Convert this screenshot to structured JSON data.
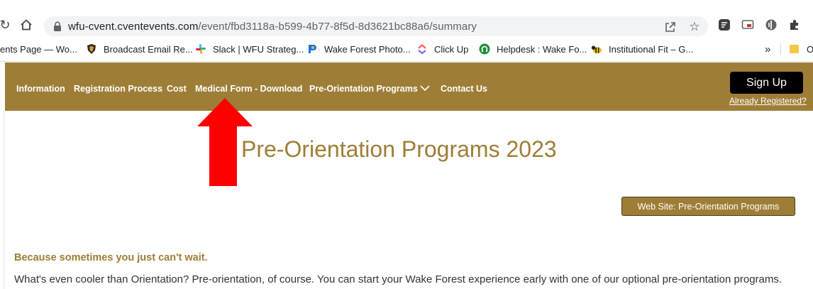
{
  "browser": {
    "url_domain": "wfu-cvent.cventevents.com",
    "url_path": "/event/fbd3118a-b599-4b77-8f5d-8d3621bc88a6/summary",
    "bookmarks": [
      {
        "label": "ents Page — Wo...",
        "icon": "page-icon"
      },
      {
        "label": "Broadcast Email Re...",
        "icon": "deacon-icon"
      },
      {
        "label": "Slack | WFU Strateg...",
        "icon": "slack-icon"
      },
      {
        "label": "Wake Forest Photo...",
        "icon": "photo-icon"
      },
      {
        "label": "Click Up",
        "icon": "clickup-icon"
      },
      {
        "label": "Helpdesk : Wake Fo...",
        "icon": "helpdesk-icon"
      },
      {
        "label": "Institutional Fit – G...",
        "icon": "bee-icon"
      }
    ],
    "bookmarks_overflow": "»",
    "other_bookmarks_label": "O"
  },
  "site_nav": {
    "items": [
      "Information",
      "Registration Process",
      "Cost",
      "Medical Form - Download",
      "Pre-Orientation Programs",
      "Contact Us"
    ],
    "signup_label": "Sign Up",
    "already_registered_label": "Already Registered?"
  },
  "page": {
    "title": "Pre-Orientation Programs 2023",
    "website_button_label": "Web Site: Pre-Orientation Programs",
    "subheading": "Because sometimes you just can't wait.",
    "body_text": "What's even cooler than Orientation? Pre-orientation, of course. You can start your Wake Forest experience early with one of our optional pre-orientation programs."
  },
  "colors": {
    "brand_gold": "#9e7e37",
    "signup_black": "#000000",
    "annotation_arrow": "#ff0000"
  }
}
